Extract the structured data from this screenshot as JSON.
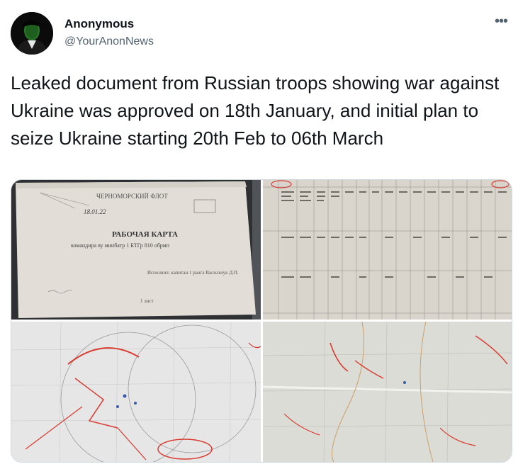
{
  "author": {
    "name": "Anonymous",
    "handle": "@YourAnonNews",
    "avatar_icon": "anonymous-mask-avatar"
  },
  "menu_icon": "more-options-icon",
  "tweet_text": "Leaked document from Russian troops showing war against Ukraine was approved on 18th January, and initial plan to seize Ukraine starting 20th Feb to 06th March",
  "media": [
    {
      "kind": "document-photo",
      "header": "ЧЕРНОМОРСКИЙ ФЛОТ",
      "handwritten_date": "18.01.22",
      "title": "РАБОЧАЯ КАРТА",
      "subtitle": "командира ву минбатр 1 БТГр 810 обрмп",
      "signature_line": "Исполнил: капитан 1 ранга Васильчук Д.П.",
      "sheet": "1 лист"
    },
    {
      "kind": "document-table-photo"
    },
    {
      "kind": "map-photo"
    },
    {
      "kind": "map-photo"
    }
  ],
  "colors": {
    "text": "#0f1419",
    "secondary": "#536471",
    "border": "#cfd9de",
    "map_red": "#d93a2f"
  }
}
